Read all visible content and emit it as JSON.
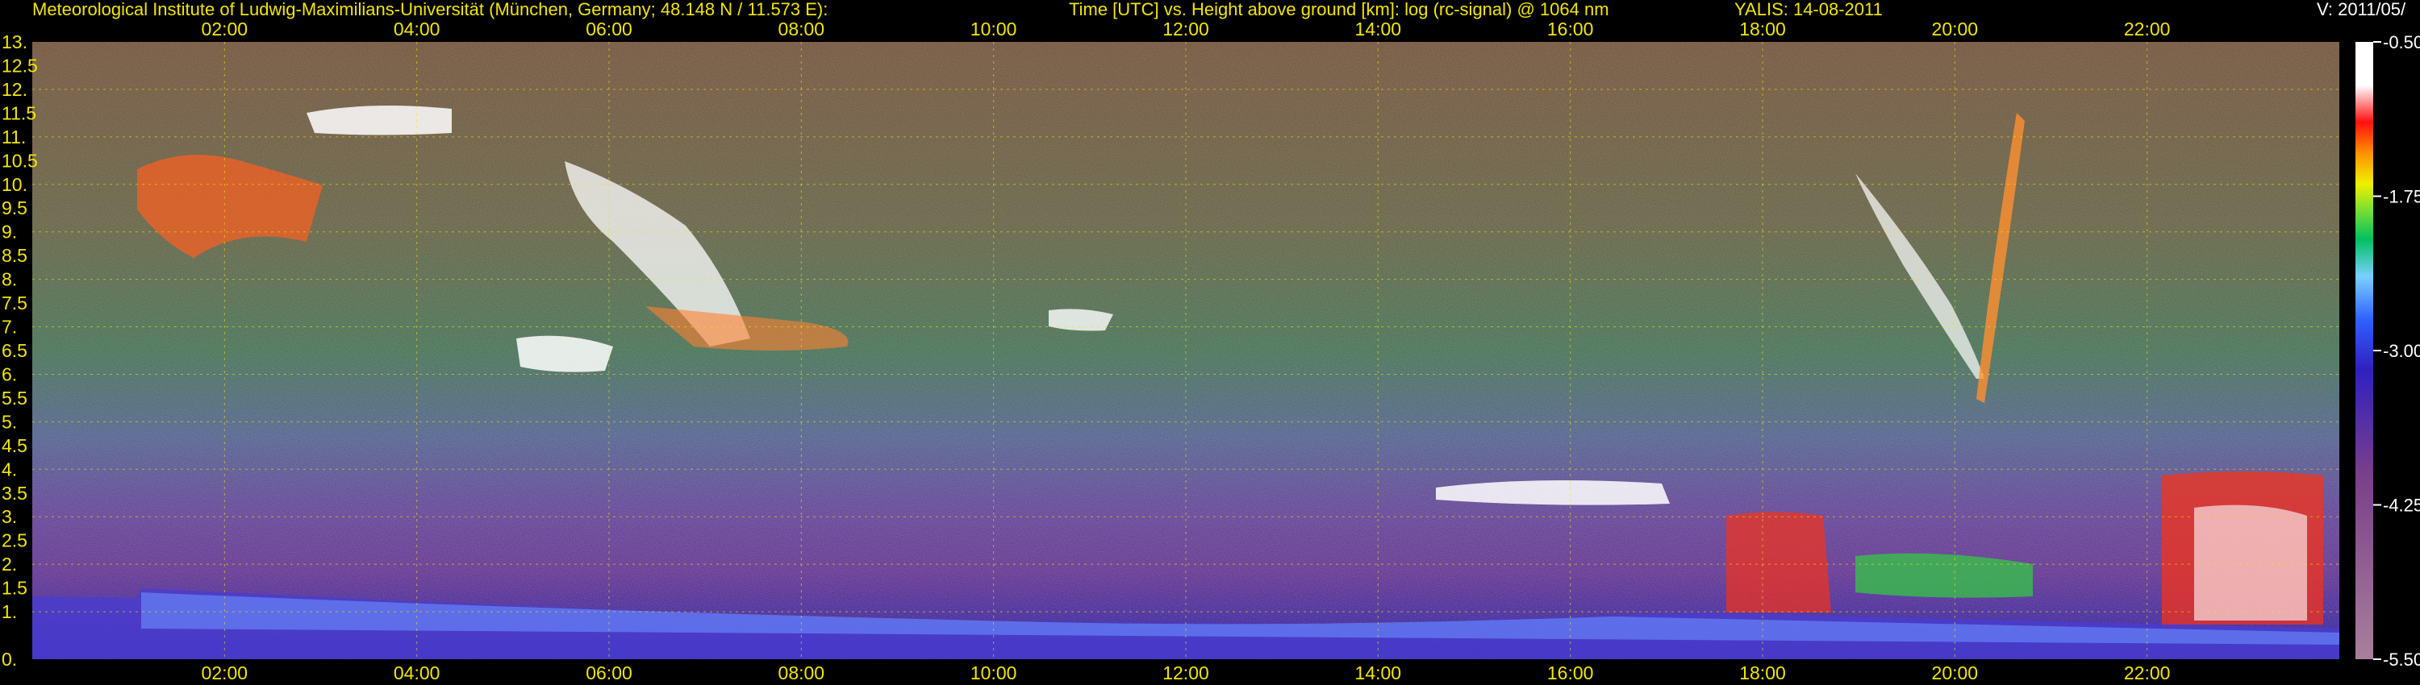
{
  "header": {
    "institute": "Meteorological Institute of Ludwig-Maximilians-Universität (München, Germany; 48.148 N / 11.573 E):",
    "description": "Time [UTC] vs. Height above ground [km]: log (rc-signal) @ 1064 nm",
    "system": "YALIS: 14-08-2011",
    "version": "V: 2011/05/"
  },
  "chart_data": {
    "type": "heatmap",
    "x_ticks": [
      "02:00",
      "04:00",
      "06:00",
      "08:00",
      "10:00",
      "12:00",
      "14:00",
      "16:00",
      "18:00",
      "20:00",
      "22:00"
    ],
    "x_tick_hours": [
      2,
      4,
      6,
      8,
      10,
      12,
      14,
      16,
      18,
      20,
      22
    ],
    "xlim_hours": [
      0,
      24
    ],
    "y_ticks": [
      "0.",
      "1.",
      "1.5",
      "2.",
      "2.5",
      "3.",
      "3.5",
      "4.",
      "4.5",
      "5.",
      "5.5",
      "6.",
      "6.5",
      "7.",
      "7.5",
      "8.",
      "8.5",
      "9.",
      "9.5",
      "10.",
      "10.5",
      "11.",
      "11.5",
      "12.",
      "12.5",
      "13."
    ],
    "y_tick_values": [
      0,
      1,
      1.5,
      2,
      2.5,
      3,
      3.5,
      4,
      4.5,
      5,
      5.5,
      6,
      6.5,
      7,
      7.5,
      8,
      8.5,
      9,
      9.5,
      10,
      10.5,
      11,
      11.5,
      12,
      12.5,
      13
    ],
    "ylim": [
      0,
      13
    ],
    "grid": true,
    "colorbar": {
      "labels": [
        "-0.50",
        "-1.75",
        "-3.00",
        "-4.25",
        "-5.50"
      ],
      "values": [
        -0.5,
        -1.75,
        -3.0,
        -4.25,
        -5.5
      ],
      "range": [
        -5.5,
        -0.5
      ],
      "colors": [
        "#a8809a",
        "#7a3f8a",
        "#3020c0",
        "#3060ff",
        "#7ad0ff",
        "#00c060",
        "#80e030",
        "#f0f000",
        "#ff9000",
        "#ff1010",
        "#ffffff"
      ]
    },
    "colors": {
      "axis_text": "#f2e600",
      "grid": "#f2e600"
    }
  }
}
